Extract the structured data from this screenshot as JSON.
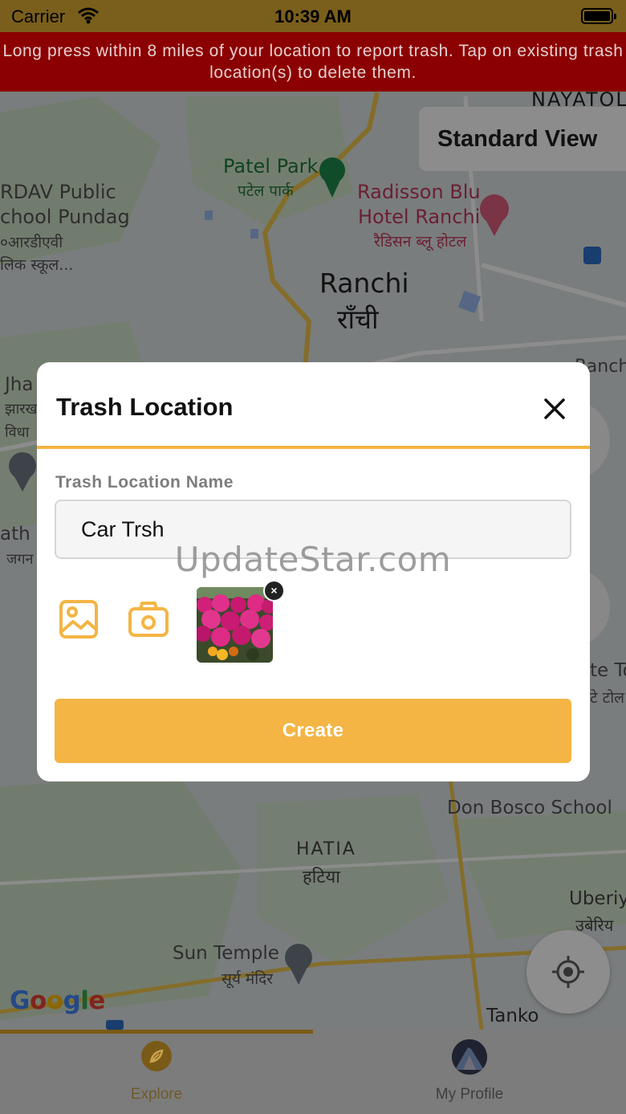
{
  "status_bar": {
    "carrier": "Carrier",
    "time": "10:39 AM"
  },
  "banner": {
    "text": "Long press within 8 miles of your location to report trash. Tap on existing trash location(s) to delete them."
  },
  "map": {
    "view_button": "Standard View",
    "labels": [
      {
        "id": "nayatoli",
        "text": "NAYATOL"
      },
      {
        "id": "patel-park",
        "text": "Patel Park"
      },
      {
        "id": "patel-park-hi",
        "text": "पटेल पार्क"
      },
      {
        "id": "radisson",
        "text": "Radisson Blu"
      },
      {
        "id": "radisson-2",
        "text": "Hotel Ranchi"
      },
      {
        "id": "radisson-hi",
        "text": "रैडिसन ब्लू होटल"
      },
      {
        "id": "dav-1",
        "text": "RDAV Public"
      },
      {
        "id": "dav-2",
        "text": "chool Pundag"
      },
      {
        "id": "dav-3",
        "text": "०आरडीएवी"
      },
      {
        "id": "dav-4",
        "text": "लिक स्कूल..."
      },
      {
        "id": "ranchi",
        "text": "Ranchi"
      },
      {
        "id": "ranchi-hi",
        "text": "राँची"
      },
      {
        "id": "ranch-right",
        "text": "Ranch"
      },
      {
        "id": "jha",
        "text": "Jha"
      },
      {
        "id": "jha-hi-1",
        "text": "झारख"
      },
      {
        "id": "jha-hi-2",
        "text": "विधा"
      },
      {
        "id": "ath",
        "text": "ath I"
      },
      {
        "id": "ath-hi",
        "text": "जगन"
      },
      {
        "id": "te-to",
        "text": "te To"
      },
      {
        "id": "te-to-hi",
        "text": "टे टोल"
      },
      {
        "id": "don-bosco",
        "text": "Don Bosco School"
      },
      {
        "id": "hatia",
        "text": "HATIA"
      },
      {
        "id": "hatia-hi",
        "text": "हटिया"
      },
      {
        "id": "uberiy",
        "text": "Uberiy"
      },
      {
        "id": "uberiy-hi",
        "text": "उबेरिय"
      },
      {
        "id": "sun-temple",
        "text": "Sun Temple"
      },
      {
        "id": "sun-temple-hi",
        "text": "सूर्य मंदिर"
      },
      {
        "id": "tanko",
        "text": "Tanko"
      }
    ],
    "google_logo": {
      "letters": [
        "G",
        "o",
        "o",
        "g",
        "l",
        "e"
      ],
      "colors": [
        "#4285f4",
        "#ea4335",
        "#fbbc05",
        "#4285f4",
        "#34a853",
        "#ea4335"
      ]
    }
  },
  "modal": {
    "title": "Trash Location",
    "field_label": "Trash Location Name",
    "field_value": "Car Trsh",
    "thumb_close": "×",
    "create_label": "Create",
    "accent_color": "#f4b544"
  },
  "watermark": "UpdateStar.com",
  "tabbar": {
    "tabs": [
      {
        "label": "Explore",
        "active": true
      },
      {
        "label": "My Profile",
        "active": false
      }
    ]
  },
  "icons": {
    "close": "close-icon",
    "gallery": "image-icon",
    "camera": "camera-icon",
    "locate": "crosshair-icon",
    "explore": "compass-icon",
    "profile": "avatar"
  }
}
